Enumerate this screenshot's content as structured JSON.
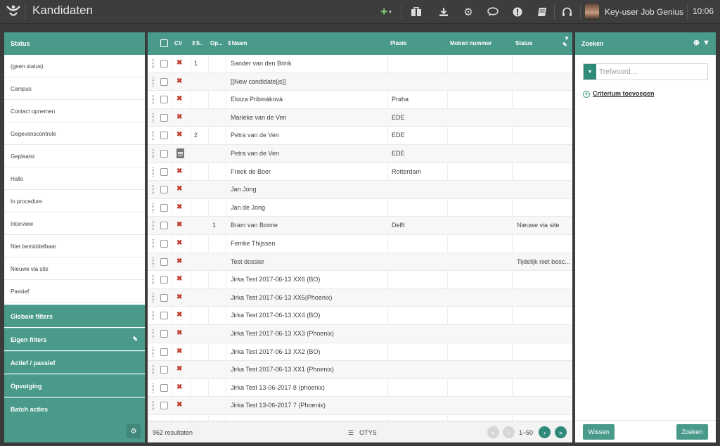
{
  "header": {
    "title": "Kandidaten",
    "user_name": "Key-user Job Genius",
    "time": "10:06",
    "icons": [
      "logo-icon",
      "add-icon",
      "briefcase-icon",
      "download-icon",
      "gear-icon",
      "chat-icon",
      "alert-icon",
      "book-icon",
      "support-icon"
    ]
  },
  "left_panel": {
    "header": "Status",
    "items": [
      "(geen status)",
      "Campus",
      "Contact opnemen",
      "Gegevenscontrole",
      "Geplaatst",
      "Hallo",
      "In procedure",
      "Interview",
      "Niet bemiddelbaar",
      "Nieuwe via site",
      "Passief"
    ],
    "sections": [
      "Globale filters",
      "Eigen filters",
      "Actief / passief",
      "Opvolging",
      "Batch acties"
    ]
  },
  "table": {
    "columns": {
      "cv": "CV",
      "s": "S..",
      "op": "Op...",
      "naam": "Naam",
      "plaats": "Plaats",
      "mobiel": "Mobiel nummer",
      "status": "Status"
    },
    "rows": [
      {
        "cv": "x",
        "s": "1",
        "op": "",
        "naam": "Sander van den Brink",
        "plaats": "",
        "status": ""
      },
      {
        "cv": "x",
        "s": "",
        "op": "",
        "naam": "[[New candidate|js]]",
        "plaats": "",
        "status": ""
      },
      {
        "cv": "x",
        "s": "",
        "op": "",
        "naam": "Eloiza Pribináková",
        "plaats": "Praha",
        "status": ""
      },
      {
        "cv": "x",
        "s": "",
        "op": "",
        "naam": "Marieke van de Ven",
        "plaats": "EDE",
        "status": ""
      },
      {
        "cv": "x",
        "s": "2",
        "op": "",
        "naam": "Petra van de Ven",
        "plaats": "EDE",
        "status": ""
      },
      {
        "cv": "doc",
        "s": "",
        "op": "",
        "naam": "Petra van de Ven",
        "plaats": "EDE",
        "status": ""
      },
      {
        "cv": "x",
        "s": "",
        "op": "",
        "naam": "Freek de Boer",
        "plaats": "Rotterdam",
        "status": ""
      },
      {
        "cv": "x",
        "s": "",
        "op": "",
        "naam": "Jan Jong",
        "plaats": "",
        "status": ""
      },
      {
        "cv": "x",
        "s": "",
        "op": "",
        "naam": "Jan de Jong",
        "plaats": "",
        "status": ""
      },
      {
        "cv": "x",
        "s": "",
        "op": "1",
        "naam": "Bram van Boone",
        "plaats": "Delft",
        "status": "Nieuwe via site"
      },
      {
        "cv": "x",
        "s": "",
        "op": "",
        "naam": "Femke Thijssen",
        "plaats": "",
        "status": ""
      },
      {
        "cv": "x",
        "s": "",
        "op": "",
        "naam": "Test dossier",
        "plaats": "",
        "status": "Tijdelijk niet besc..."
      },
      {
        "cv": "x",
        "s": "",
        "op": "",
        "naam": "Jirka Test 2017-06-13 XX6 (BO)",
        "plaats": "",
        "status": ""
      },
      {
        "cv": "x",
        "s": "",
        "op": "",
        "naam": "Jirka Test 2017-06-13 XX5(Phoenix)",
        "plaats": "",
        "status": ""
      },
      {
        "cv": "x",
        "s": "",
        "op": "",
        "naam": "Jirka Test 2017-06-13 XX4 (BO)",
        "plaats": "",
        "status": ""
      },
      {
        "cv": "x",
        "s": "",
        "op": "",
        "naam": "Jirka Test 2017-06-13 XX3 (Phoenix)",
        "plaats": "",
        "status": ""
      },
      {
        "cv": "x",
        "s": "",
        "op": "",
        "naam": "Jirka Test 2017-06-13 XX2 (BO)",
        "plaats": "",
        "status": ""
      },
      {
        "cv": "x",
        "s": "",
        "op": "",
        "naam": "Jirka Test 2017-06-13 XX1 (Phoenix)",
        "plaats": "",
        "status": ""
      },
      {
        "cv": "x",
        "s": "",
        "op": "",
        "naam": "Jirka Test 13-06-2017 8 (phoenix)",
        "plaats": "",
        "status": ""
      },
      {
        "cv": "x",
        "s": "",
        "op": "",
        "naam": "Jirka Test 13-06-2017 7 (Phoenix)",
        "plaats": "",
        "status": ""
      }
    ],
    "footer": {
      "results": "962 resultaten",
      "otys": "OTYS",
      "range": "1–50"
    }
  },
  "right_panel": {
    "header": "Zoeken",
    "search_placeholder": "Trefwoord...",
    "add_criterium": "Criterium toevoegen",
    "clear_button": "Wissen",
    "search_button": "Zoeken"
  },
  "colors": {
    "accent": "#4a9a8c",
    "accent_dark": "#2f8a79",
    "topbar": "#3d3d3d",
    "cv_missing": "#c0392b"
  }
}
